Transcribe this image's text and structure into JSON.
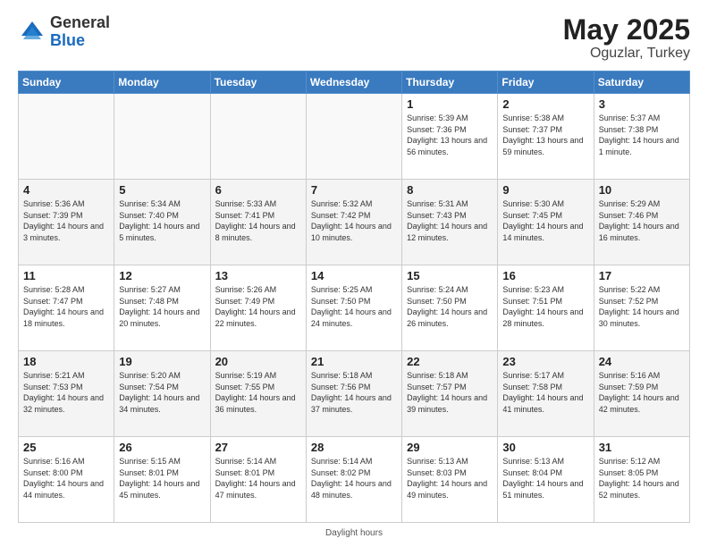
{
  "header": {
    "logo_general": "General",
    "logo_blue": "Blue",
    "title": "May 2025",
    "location": "Oguzlar, Turkey"
  },
  "footer": {
    "daylight_hours": "Daylight hours"
  },
  "days_of_week": [
    "Sunday",
    "Monday",
    "Tuesday",
    "Wednesday",
    "Thursday",
    "Friday",
    "Saturday"
  ],
  "weeks": [
    [
      {
        "day": "",
        "text": ""
      },
      {
        "day": "",
        "text": ""
      },
      {
        "day": "",
        "text": ""
      },
      {
        "day": "",
        "text": ""
      },
      {
        "day": "1",
        "text": "Sunrise: 5:39 AM\nSunset: 7:36 PM\nDaylight: 13 hours and 56 minutes."
      },
      {
        "day": "2",
        "text": "Sunrise: 5:38 AM\nSunset: 7:37 PM\nDaylight: 13 hours and 59 minutes."
      },
      {
        "day": "3",
        "text": "Sunrise: 5:37 AM\nSunset: 7:38 PM\nDaylight: 14 hours and 1 minute."
      }
    ],
    [
      {
        "day": "4",
        "text": "Sunrise: 5:36 AM\nSunset: 7:39 PM\nDaylight: 14 hours and 3 minutes."
      },
      {
        "day": "5",
        "text": "Sunrise: 5:34 AM\nSunset: 7:40 PM\nDaylight: 14 hours and 5 minutes."
      },
      {
        "day": "6",
        "text": "Sunrise: 5:33 AM\nSunset: 7:41 PM\nDaylight: 14 hours and 8 minutes."
      },
      {
        "day": "7",
        "text": "Sunrise: 5:32 AM\nSunset: 7:42 PM\nDaylight: 14 hours and 10 minutes."
      },
      {
        "day": "8",
        "text": "Sunrise: 5:31 AM\nSunset: 7:43 PM\nDaylight: 14 hours and 12 minutes."
      },
      {
        "day": "9",
        "text": "Sunrise: 5:30 AM\nSunset: 7:45 PM\nDaylight: 14 hours and 14 minutes."
      },
      {
        "day": "10",
        "text": "Sunrise: 5:29 AM\nSunset: 7:46 PM\nDaylight: 14 hours and 16 minutes."
      }
    ],
    [
      {
        "day": "11",
        "text": "Sunrise: 5:28 AM\nSunset: 7:47 PM\nDaylight: 14 hours and 18 minutes."
      },
      {
        "day": "12",
        "text": "Sunrise: 5:27 AM\nSunset: 7:48 PM\nDaylight: 14 hours and 20 minutes."
      },
      {
        "day": "13",
        "text": "Sunrise: 5:26 AM\nSunset: 7:49 PM\nDaylight: 14 hours and 22 minutes."
      },
      {
        "day": "14",
        "text": "Sunrise: 5:25 AM\nSunset: 7:50 PM\nDaylight: 14 hours and 24 minutes."
      },
      {
        "day": "15",
        "text": "Sunrise: 5:24 AM\nSunset: 7:50 PM\nDaylight: 14 hours and 26 minutes."
      },
      {
        "day": "16",
        "text": "Sunrise: 5:23 AM\nSunset: 7:51 PM\nDaylight: 14 hours and 28 minutes."
      },
      {
        "day": "17",
        "text": "Sunrise: 5:22 AM\nSunset: 7:52 PM\nDaylight: 14 hours and 30 minutes."
      }
    ],
    [
      {
        "day": "18",
        "text": "Sunrise: 5:21 AM\nSunset: 7:53 PM\nDaylight: 14 hours and 32 minutes."
      },
      {
        "day": "19",
        "text": "Sunrise: 5:20 AM\nSunset: 7:54 PM\nDaylight: 14 hours and 34 minutes."
      },
      {
        "day": "20",
        "text": "Sunrise: 5:19 AM\nSunset: 7:55 PM\nDaylight: 14 hours and 36 minutes."
      },
      {
        "day": "21",
        "text": "Sunrise: 5:18 AM\nSunset: 7:56 PM\nDaylight: 14 hours and 37 minutes."
      },
      {
        "day": "22",
        "text": "Sunrise: 5:18 AM\nSunset: 7:57 PM\nDaylight: 14 hours and 39 minutes."
      },
      {
        "day": "23",
        "text": "Sunrise: 5:17 AM\nSunset: 7:58 PM\nDaylight: 14 hours and 41 minutes."
      },
      {
        "day": "24",
        "text": "Sunrise: 5:16 AM\nSunset: 7:59 PM\nDaylight: 14 hours and 42 minutes."
      }
    ],
    [
      {
        "day": "25",
        "text": "Sunrise: 5:16 AM\nSunset: 8:00 PM\nDaylight: 14 hours and 44 minutes."
      },
      {
        "day": "26",
        "text": "Sunrise: 5:15 AM\nSunset: 8:01 PM\nDaylight: 14 hours and 45 minutes."
      },
      {
        "day": "27",
        "text": "Sunrise: 5:14 AM\nSunset: 8:01 PM\nDaylight: 14 hours and 47 minutes."
      },
      {
        "day": "28",
        "text": "Sunrise: 5:14 AM\nSunset: 8:02 PM\nDaylight: 14 hours and 48 minutes."
      },
      {
        "day": "29",
        "text": "Sunrise: 5:13 AM\nSunset: 8:03 PM\nDaylight: 14 hours and 49 minutes."
      },
      {
        "day": "30",
        "text": "Sunrise: 5:13 AM\nSunset: 8:04 PM\nDaylight: 14 hours and 51 minutes."
      },
      {
        "day": "31",
        "text": "Sunrise: 5:12 AM\nSunset: 8:05 PM\nDaylight: 14 hours and 52 minutes."
      }
    ]
  ]
}
